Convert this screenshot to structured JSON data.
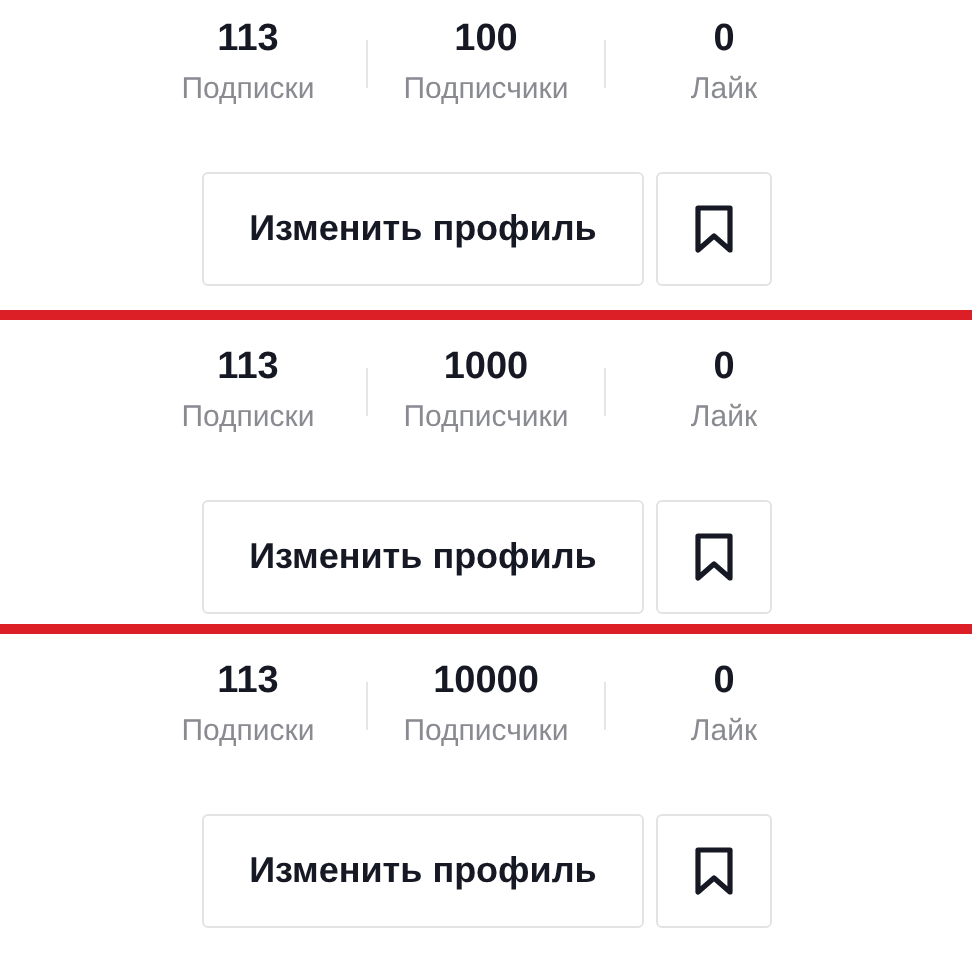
{
  "panels": [
    {
      "stats": [
        {
          "value": "113",
          "label": "Подписки"
        },
        {
          "value": "100",
          "label": "Подписчики"
        },
        {
          "value": "0",
          "label": "Лайк"
        }
      ],
      "edit_button": "Изменить профиль"
    },
    {
      "stats": [
        {
          "value": "113",
          "label": "Подписки"
        },
        {
          "value": "1000",
          "label": "Подписчики"
        },
        {
          "value": "0",
          "label": "Лайк"
        }
      ],
      "edit_button": "Изменить профиль"
    },
    {
      "stats": [
        {
          "value": "113",
          "label": "Подписки"
        },
        {
          "value": "10000",
          "label": "Подписчики"
        },
        {
          "value": "0",
          "label": "Лайк"
        }
      ],
      "edit_button": "Изменить профиль"
    }
  ]
}
